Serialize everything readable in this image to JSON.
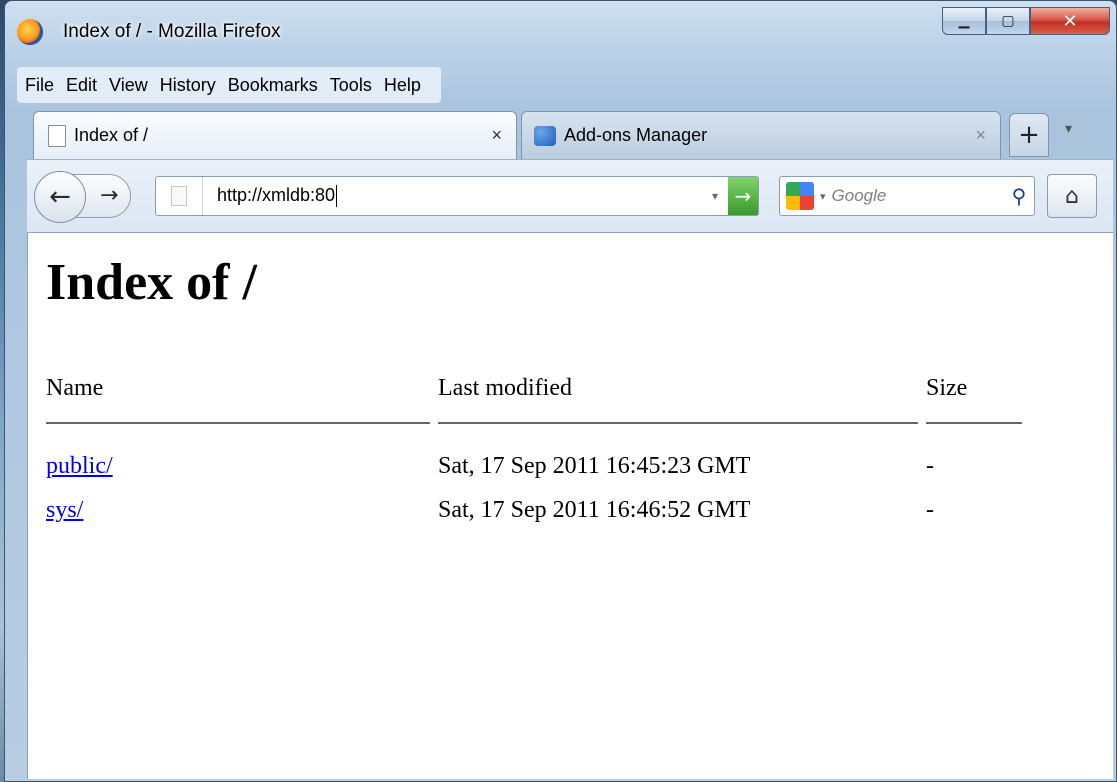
{
  "window": {
    "title": "Index of / - Mozilla Firefox",
    "caption_buttons": {
      "minimize": "▁",
      "maximize": "▢",
      "close": "✕"
    }
  },
  "menubar": {
    "items": [
      "File",
      "Edit",
      "View",
      "History",
      "Bookmarks",
      "Tools",
      "Help"
    ]
  },
  "tabs": [
    {
      "label": "Index of /",
      "active": true,
      "close": "×"
    },
    {
      "label": "Add-ons Manager",
      "active": false,
      "close": "×"
    }
  ],
  "new_tab": "+",
  "navbar": {
    "back": "←",
    "forward": "→",
    "url": "http://xmldb:80",
    "go": "→",
    "search_placeholder": "Google",
    "search_icon": "⚲",
    "home": "⌂"
  },
  "page": {
    "heading": "Index of /",
    "columns": [
      "Name",
      "Last modified",
      "Size"
    ],
    "rows": [
      {
        "name": "public/",
        "modified": "Sat, 17 Sep 2011 16:45:23 GMT",
        "size": "-"
      },
      {
        "name": "sys/",
        "modified": "Sat, 17 Sep 2011 16:46:52 GMT",
        "size": "-"
      }
    ]
  },
  "colors": {
    "link": "#0000ee",
    "go_button": "#3b9a2d",
    "close_button": "#c1301f"
  }
}
